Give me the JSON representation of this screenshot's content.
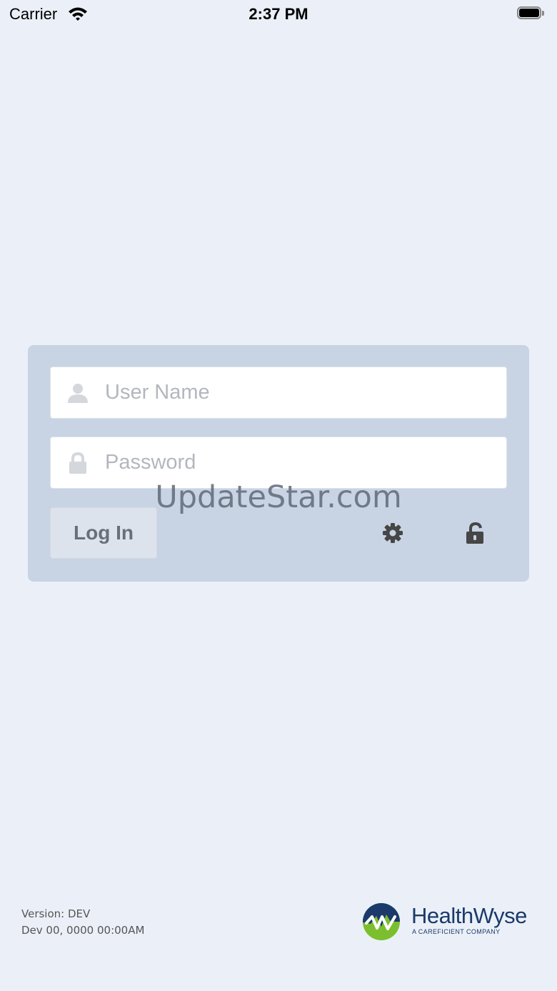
{
  "status_bar": {
    "carrier": "Carrier",
    "time": "2:37 PM",
    "wifi_icon": "wifi-icon",
    "battery_icon": "battery-full-icon"
  },
  "login": {
    "username": {
      "placeholder": "User Name",
      "value": "",
      "icon": "user-icon"
    },
    "password": {
      "placeholder": "Password",
      "value": "",
      "icon": "lock-icon"
    },
    "login_label": "Log In",
    "settings_icon": "gear-icon",
    "unlock_icon": "unlock-icon"
  },
  "watermark": "UpdateStar.com",
  "footer": {
    "version_line": "Version: DEV",
    "build_line": "Dev 00, 0000 00:00AM"
  },
  "logo": {
    "brand": "HealthWyse",
    "tagline": "A CAREFICIENT COMPANY"
  },
  "colors": {
    "background": "#ebf0f8",
    "panel": "#c8d3e3",
    "brand_navy": "#1b3a6b",
    "brand_green": "#7cbf2e"
  }
}
